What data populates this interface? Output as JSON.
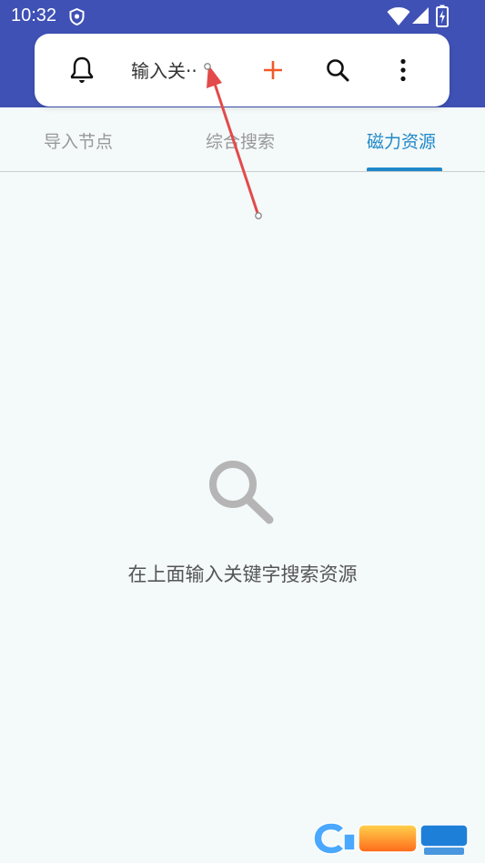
{
  "status_bar": {
    "time": "10:32"
  },
  "search_bar": {
    "query_text": "输入关··",
    "icons": [
      "bell-icon",
      "plus-icon",
      "search-icon",
      "more-vertical-icon"
    ]
  },
  "tabs": [
    {
      "label": "导入节点",
      "selected": false
    },
    {
      "label": "综合搜索",
      "selected": false
    },
    {
      "label": "磁力资源",
      "selected": true
    }
  ],
  "empty_state": {
    "message": "在上面输入关键字搜索资源",
    "icon": "search-icon"
  },
  "colors": {
    "status_bar": "#3f51b5",
    "accent": "#1e88c9",
    "add_button": "#f05a28",
    "annotation_arrow": "#e34a4a",
    "background": "#f4f9f9"
  },
  "watermark": {
    "logo": "cr173-watermark"
  }
}
